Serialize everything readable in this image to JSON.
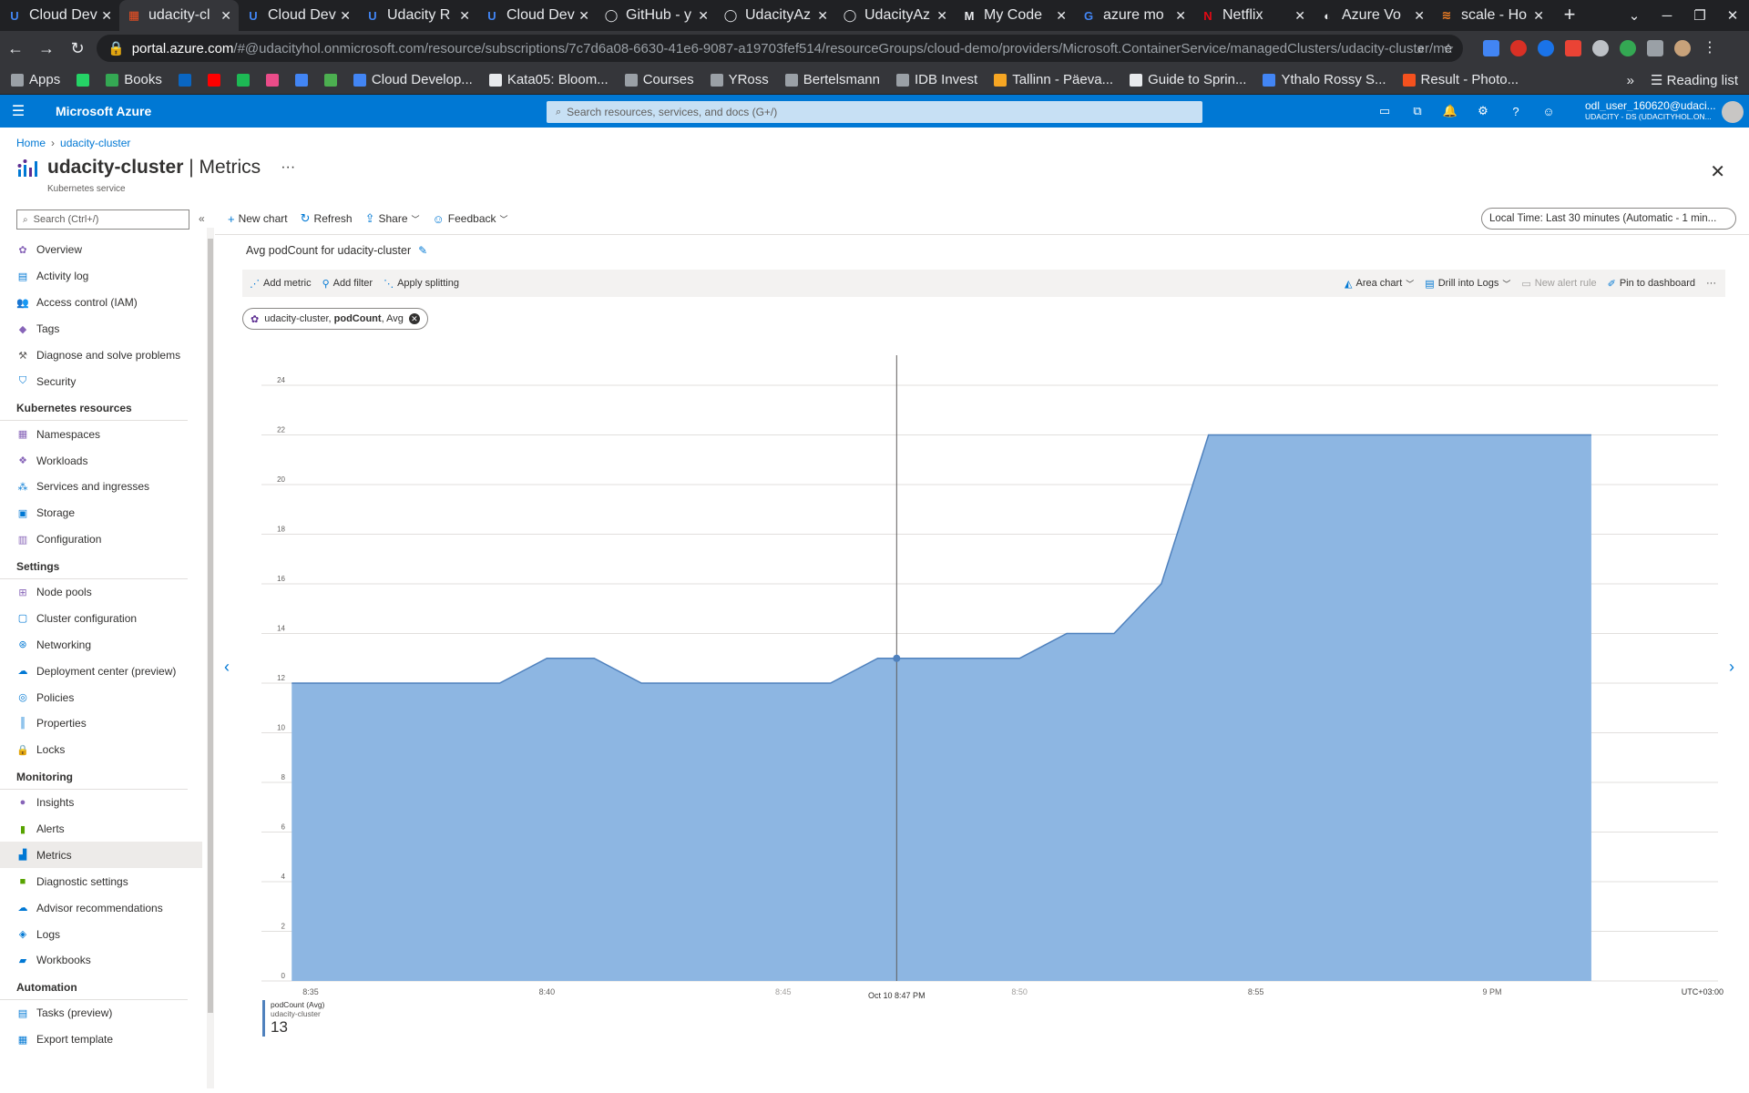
{
  "browser": {
    "tabs": [
      {
        "title": "Cloud Dev",
        "fav": "U",
        "favColor": "#4285f4",
        "active": false
      },
      {
        "title": "udacity-cl",
        "fav": "▦",
        "favColor": "#f25022",
        "active": true
      },
      {
        "title": "Cloud Dev",
        "fav": "U",
        "favColor": "#4285f4",
        "active": false
      },
      {
        "title": "Udacity R",
        "fav": "U",
        "favColor": "#4285f4",
        "active": false
      },
      {
        "title": "Cloud Dev",
        "fav": "U",
        "favColor": "#4285f4",
        "active": false
      },
      {
        "title": "GitHub - y",
        "fav": "◯",
        "favColor": "#e8eaed",
        "active": false
      },
      {
        "title": "UdacityAz",
        "fav": "◯",
        "favColor": "#e8eaed",
        "active": false
      },
      {
        "title": "UdacityAz",
        "fav": "◯",
        "favColor": "#e8eaed",
        "active": false
      },
      {
        "title": "My Code",
        "fav": "M",
        "favColor": "#e8eaed",
        "active": false
      },
      {
        "title": "azure mo",
        "fav": "G",
        "favColor": "#4285f4",
        "active": false
      },
      {
        "title": "Netflix",
        "fav": "N",
        "favColor": "#e50914",
        "active": false
      },
      {
        "title": "Azure Vo",
        "fav": "◐",
        "favColor": "#e8eaed",
        "active": false
      },
      {
        "title": "scale - Ho",
        "fav": "≋",
        "favColor": "#f48024",
        "active": false
      }
    ],
    "url_host": "portal.azure.com",
    "url_path": "/#@udacityhol.onmicrosoft.com/resource/subscriptions/7c7d6a08-6630-41e6-9087-a19703fef514/resourceGroups/cloud-demo/providers/Microsoft.ContainerService/managedClusters/udacity-cluster/met...",
    "bookmarks": [
      {
        "label": "Apps",
        "color": "#9aa0a6"
      },
      {
        "label": "",
        "color": "#25d366"
      },
      {
        "label": "Books",
        "color": "#34a853"
      },
      {
        "label": "",
        "color": "#0a66c2"
      },
      {
        "label": "",
        "color": "#ff0000"
      },
      {
        "label": "",
        "color": "#1db954"
      },
      {
        "label": "",
        "color": "#ea4c89"
      },
      {
        "label": "",
        "color": "#4285f4"
      },
      {
        "label": "",
        "color": "#4caf50"
      },
      {
        "label": "Cloud Develop...",
        "color": "#4285f4"
      },
      {
        "label": "Kata05: Bloom...",
        "color": "#e8eaed"
      },
      {
        "label": "Courses",
        "color": "#9aa0a6"
      },
      {
        "label": "YRoss",
        "color": "#9aa0a6"
      },
      {
        "label": "Bertelsmann",
        "color": "#9aa0a6"
      },
      {
        "label": "IDB Invest",
        "color": "#9aa0a6"
      },
      {
        "label": "Tallinn - Päeva...",
        "color": "#f6a623"
      },
      {
        "label": "Guide to Sprin...",
        "color": "#e8eaed"
      },
      {
        "label": "Ythalo Rossy S...",
        "color": "#4285f4"
      },
      {
        "label": "Result - Photo...",
        "color": "#f4511e"
      }
    ],
    "more_label": "»",
    "reading_list": "Reading list"
  },
  "azure": {
    "brand": "Microsoft Azure",
    "search_placeholder": "Search resources, services, and docs (G+/)",
    "user_name": "odl_user_160620@udaci...",
    "user_tenant": "UDACITY - DS (UDACITYHOL.ON..."
  },
  "breadcrumb": [
    "Home",
    "udacity-cluster"
  ],
  "page": {
    "resource": "udacity-cluster",
    "separator": " | ",
    "blade": "Metrics",
    "more": "···",
    "subtitle": "Kubernetes service",
    "close": "✕"
  },
  "sidebar": {
    "search_placeholder": "Search (Ctrl+/)",
    "collapse": "«",
    "items": [
      {
        "type": "item",
        "label": "Overview",
        "icon": "✿",
        "color": "#8764b8"
      },
      {
        "type": "item",
        "label": "Activity log",
        "icon": "▤",
        "color": "#0078d4"
      },
      {
        "type": "item",
        "label": "Access control (IAM)",
        "icon": "👥",
        "color": "#0078d4"
      },
      {
        "type": "item",
        "label": "Tags",
        "icon": "◆",
        "color": "#8764b8"
      },
      {
        "type": "item",
        "label": "Diagnose and solve problems",
        "icon": "⚒",
        "color": "#605e5c"
      },
      {
        "type": "item",
        "label": "Security",
        "icon": "⛉",
        "color": "#0078d4"
      },
      {
        "type": "head",
        "label": "Kubernetes resources"
      },
      {
        "type": "item",
        "label": "Namespaces",
        "icon": "▦",
        "color": "#8764b8"
      },
      {
        "type": "item",
        "label": "Workloads",
        "icon": "❖",
        "color": "#8764b8"
      },
      {
        "type": "item",
        "label": "Services and ingresses",
        "icon": "⁂",
        "color": "#0078d4"
      },
      {
        "type": "item",
        "label": "Storage",
        "icon": "▣",
        "color": "#0078d4"
      },
      {
        "type": "item",
        "label": "Configuration",
        "icon": "▥",
        "color": "#8764b8"
      },
      {
        "type": "head",
        "label": "Settings"
      },
      {
        "type": "item",
        "label": "Node pools",
        "icon": "⊞",
        "color": "#8764b8"
      },
      {
        "type": "item",
        "label": "Cluster configuration",
        "icon": "▢",
        "color": "#0078d4"
      },
      {
        "type": "item",
        "label": "Networking",
        "icon": "⊛",
        "color": "#0078d4"
      },
      {
        "type": "item",
        "label": "Deployment center (preview)",
        "icon": "☁",
        "color": "#0078d4"
      },
      {
        "type": "item",
        "label": "Policies",
        "icon": "◎",
        "color": "#0078d4"
      },
      {
        "type": "item",
        "label": "Properties",
        "icon": "║",
        "color": "#0078d4"
      },
      {
        "type": "item",
        "label": "Locks",
        "icon": "🔒",
        "color": "#0078d4"
      },
      {
        "type": "head",
        "label": "Monitoring"
      },
      {
        "type": "item",
        "label": "Insights",
        "icon": "●",
        "color": "#8764b8"
      },
      {
        "type": "item",
        "label": "Alerts",
        "icon": "▮",
        "color": "#57a300"
      },
      {
        "type": "item",
        "label": "Metrics",
        "icon": "▟",
        "color": "#0078d4",
        "active": true
      },
      {
        "type": "item",
        "label": "Diagnostic settings",
        "icon": "■",
        "color": "#57a300"
      },
      {
        "type": "item",
        "label": "Advisor recommendations",
        "icon": "☁",
        "color": "#0078d4"
      },
      {
        "type": "item",
        "label": "Logs",
        "icon": "◈",
        "color": "#0078d4"
      },
      {
        "type": "item",
        "label": "Workbooks",
        "icon": "▰",
        "color": "#0078d4"
      },
      {
        "type": "head",
        "label": "Automation"
      },
      {
        "type": "item",
        "label": "Tasks (preview)",
        "icon": "▤",
        "color": "#0078d4"
      },
      {
        "type": "item",
        "label": "Export template",
        "icon": "▦",
        "color": "#0078d4"
      }
    ]
  },
  "commands": {
    "new_chart": "New chart",
    "refresh": "Refresh",
    "share": "Share",
    "feedback": "Feedback",
    "time_range": "Local Time: Last 30 minutes (Automatic - 1 min..."
  },
  "chart_panel": {
    "title": "Avg podCount for udacity-cluster",
    "add_metric": "Add metric",
    "add_filter": "Add filter",
    "apply_splitting": "Apply splitting",
    "area_chart": "Area chart",
    "drill_logs": "Drill into Logs",
    "new_alert": "New alert rule",
    "pin": "Pin to dashboard",
    "more": "···",
    "pill_resource": "udacity-cluster, ",
    "pill_metric": "podCount",
    "pill_agg": ", Avg",
    "cursor_label": "Oct 10 8:47 PM",
    "timezone": "UTC+03:00",
    "legend_name": "podCount (Avg)",
    "legend_resource": "udacity-cluster",
    "legend_value": "13"
  },
  "chart_data": {
    "type": "area",
    "ylim": [
      0,
      24
    ],
    "yticks": [
      0,
      2,
      4,
      6,
      8,
      10,
      12,
      14,
      16,
      18,
      20,
      22,
      24
    ],
    "xlim": [
      34,
      63.5
    ],
    "xticks": [
      {
        "v": 35,
        "label": "8:35"
      },
      {
        "v": 40,
        "label": "8:40"
      },
      {
        "v": 45,
        "label": "8:45"
      },
      {
        "v": 50,
        "label": "8:50"
      },
      {
        "v": 55,
        "label": "8:55"
      },
      {
        "v": 60,
        "label": "9 PM"
      }
    ],
    "cursor_x": 47.4,
    "color": "#4f81bd",
    "fill": "#8db6e2",
    "series": [
      {
        "name": "podCount (Avg)",
        "x": [
          34.6,
          39,
          40,
          41,
          42,
          46,
          47,
          48,
          49,
          50,
          51,
          52,
          53,
          54,
          55,
          62.1
        ],
        "y": [
          12,
          12,
          13,
          13,
          12,
          12,
          13,
          13,
          13,
          13,
          14,
          14,
          16,
          22,
          22,
          22
        ]
      }
    ],
    "marker": {
      "x": 47.4,
      "y": 13
    }
  }
}
